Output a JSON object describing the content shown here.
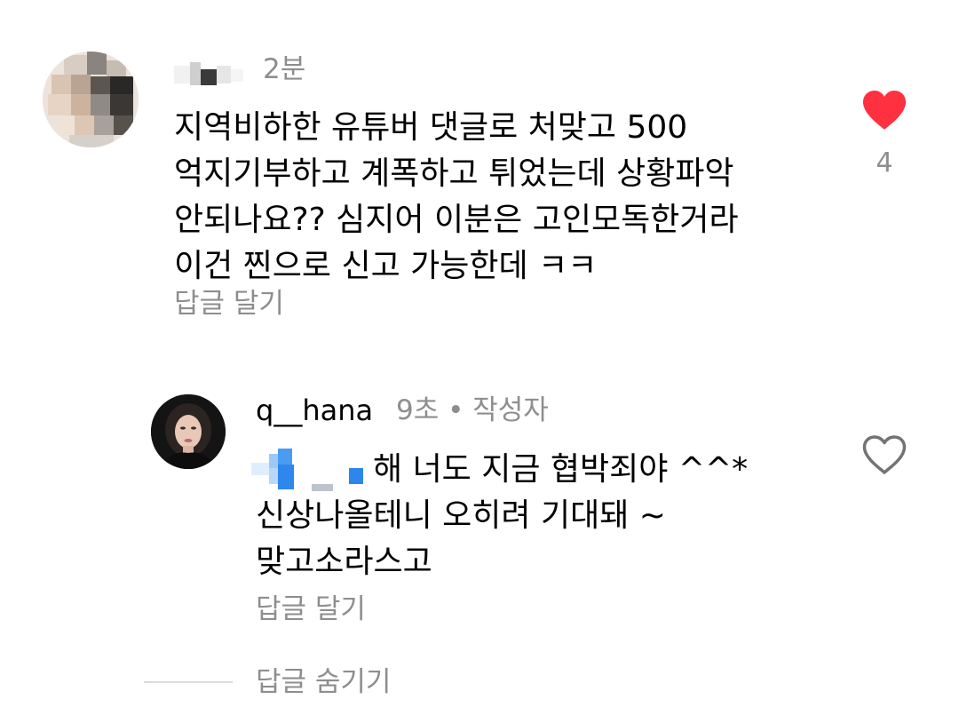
{
  "comment1": {
    "time": "2분",
    "lines": [
      "지역비하한 유튜버 댓글로 처맞고 500",
      "억지기부하고 계폭하고 튀었는데 상황파악",
      "안되나요?? 심지어 이분은 고인모독한거라",
      "이건 찐으로 신고 가능한데 ㅋㅋ"
    ],
    "reply_label": "답글 달기",
    "likes": "4",
    "liked": true
  },
  "comment2": {
    "username": "q__hana",
    "meta": "9초 • 작성자",
    "lines": [
      "해 너도 지금 협박죄야 ^^*",
      "신상나올테니 오히려 기대돼 ~",
      "맞고소라스고"
    ],
    "reply_label": "답글 달기",
    "liked": false
  },
  "hide_replies_label": "답글 숨기기",
  "colors": {
    "text": "#000000",
    "secondary": "#8e8e8e",
    "like_red": "#ff3040",
    "divider": "#dbdbdb",
    "mention_blur": "#6aa8e8"
  },
  "icons": {
    "liked": "heart-filled-icon",
    "not_liked": "heart-outline-icon"
  }
}
